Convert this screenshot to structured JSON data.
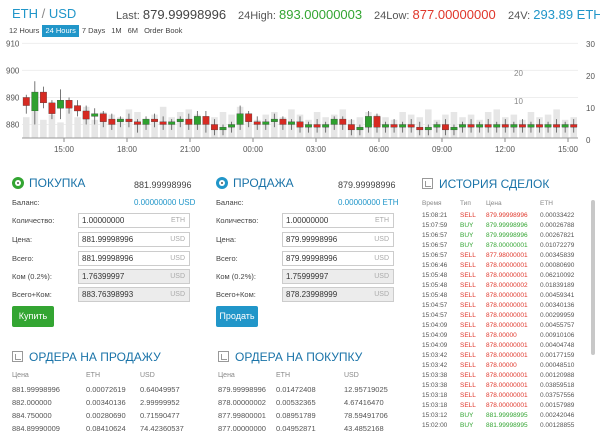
{
  "header": {
    "base": "ETH",
    "quote": "USD",
    "last_label": "Last:",
    "last_value": "879.99998996",
    "high_label": "24High:",
    "high_value": "893.00000003",
    "low_label": "24Low:",
    "low_value": "877.00000000",
    "vol_label": "24V:",
    "vol_value": "293.89 ETH"
  },
  "periods": [
    "12 Hours",
    "24 Hours",
    "7 Days",
    "1M",
    "6M",
    "Order Book"
  ],
  "active_period": "24 Hours",
  "chart_data": {
    "type": "candlestick",
    "y_ticks_left": [
      "910",
      "900",
      "890",
      "880"
    ],
    "y_ticks_right": [
      "30",
      "20",
      "10",
      "0"
    ],
    "y_ticks_right_partial": [
      "20",
      "10"
    ],
    "x_ticks": [
      "15:00",
      "18:00",
      "21:00",
      "00:00",
      "03:00",
      "06:00",
      "09:00",
      "12:00",
      "15:00"
    ],
    "colors": {
      "up": "#2ea02e",
      "down": "#d62a22",
      "volume": "#e6e6e6"
    },
    "candles": [
      [
        890,
        891,
        887,
        884
      ],
      [
        885,
        896,
        892,
        880
      ],
      [
        892,
        894,
        888,
        886
      ],
      [
        888,
        889,
        884,
        882
      ],
      [
        886,
        893,
        889,
        882
      ],
      [
        889,
        890,
        886,
        884
      ],
      [
        887,
        889,
        885,
        883
      ],
      [
        885,
        887,
        882,
        880
      ],
      [
        883,
        886,
        884,
        880
      ],
      [
        884,
        885,
        881,
        879
      ],
      [
        882,
        884,
        880,
        878
      ],
      [
        881,
        883,
        882,
        879
      ],
      [
        882,
        884,
        881,
        879
      ],
      [
        881,
        882,
        880,
        877
      ],
      [
        880,
        883,
        882,
        878
      ],
      [
        882,
        884,
        881,
        879
      ],
      [
        881,
        883,
        880,
        878
      ],
      [
        880,
        882,
        881,
        878
      ],
      [
        881,
        883,
        882,
        879
      ],
      [
        882,
        884,
        880,
        878
      ],
      [
        880,
        885,
        883,
        878
      ],
      [
        883,
        885,
        880,
        877
      ],
      [
        880,
        882,
        878,
        876
      ],
      [
        878,
        880,
        879,
        876
      ],
      [
        879,
        881,
        880,
        877
      ],
      [
        880,
        887,
        884,
        878
      ],
      [
        884,
        885,
        881,
        879
      ],
      [
        881,
        883,
        880,
        878
      ],
      [
        880,
        882,
        881,
        878
      ],
      [
        881,
        884,
        882,
        879
      ],
      [
        882,
        883,
        880,
        878
      ],
      [
        880,
        882,
        881,
        878
      ],
      [
        881,
        883,
        879,
        877
      ],
      [
        879,
        881,
        880,
        877
      ],
      [
        880,
        882,
        879,
        877
      ],
      [
        879,
        881,
        880,
        877
      ],
      [
        880,
        883,
        882,
        878
      ],
      [
        882,
        883,
        880,
        878
      ],
      [
        880,
        882,
        878,
        876
      ],
      [
        878,
        880,
        879,
        876
      ],
      [
        879,
        885,
        883,
        877
      ],
      [
        883,
        884,
        879,
        877
      ],
      [
        879,
        881,
        880,
        877
      ],
      [
        880,
        882,
        879,
        877
      ],
      [
        879,
        881,
        880,
        877
      ],
      [
        880,
        882,
        879,
        877
      ],
      [
        879,
        881,
        878,
        876
      ],
      [
        878,
        880,
        879,
        876
      ],
      [
        879,
        881,
        880,
        877
      ],
      [
        880,
        882,
        878,
        876
      ],
      [
        878,
        880,
        879,
        876
      ],
      [
        879,
        881,
        880,
        877
      ],
      [
        880,
        882,
        879,
        877
      ],
      [
        879,
        881,
        880,
        877
      ],
      [
        880,
        882,
        879,
        877
      ],
      [
        879,
        881,
        880,
        877
      ],
      [
        880,
        882,
        879,
        877
      ],
      [
        879,
        881,
        880,
        877
      ],
      [
        880,
        882,
        879,
        877
      ],
      [
        879,
        881,
        880,
        877
      ],
      [
        880,
        882,
        879,
        877
      ],
      [
        879,
        881,
        880,
        877
      ],
      [
        880,
        882,
        879,
        877
      ],
      [
        879,
        881,
        880,
        877
      ],
      [
        880,
        882,
        879,
        877
      ]
    ],
    "volumes": [
      8,
      10,
      7,
      9,
      6,
      11,
      8,
      12,
      7,
      10,
      9,
      8,
      11,
      10,
      7,
      9,
      12,
      8,
      10,
      11,
      9,
      7,
      8,
      10,
      9,
      12,
      8,
      7,
      9,
      10,
      8,
      11,
      9,
      7,
      10,
      8,
      9,
      11,
      7,
      8,
      10,
      9,
      8,
      7,
      10,
      9,
      8,
      11,
      7,
      9,
      10,
      8,
      9,
      7,
      10,
      11,
      8,
      9,
      7,
      10,
      8,
      9,
      11,
      7,
      8
    ]
  },
  "buy": {
    "title": "ПОКУПКА",
    "top_value": "881.99998996",
    "balance_label": "Баланс:",
    "balance_value": "0.00000000 USD",
    "qty_label": "Количество:",
    "qty_value": "1.00000000",
    "qty_unit": "ETH",
    "price_label": "Цена:",
    "price_value": "881.99998996",
    "price_unit": "USD",
    "total_label": "Всего:",
    "total_value": "881.99998996",
    "total_unit": "USD",
    "fee_label": "Ком (0.2%):",
    "fee_value": "1.76399997",
    "fee_unit": "USD",
    "grand_label": "Всего+Ком:",
    "grand_value": "883.76398993",
    "grand_unit": "USD",
    "button": "Купить"
  },
  "sell": {
    "title": "ПРОДАЖА",
    "top_value": "879.99998996",
    "balance_label": "Баланс:",
    "balance_value": "0.00000000 ETH",
    "qty_label": "Количество:",
    "qty_value": "1.00000000",
    "qty_unit": "ETH",
    "price_label": "Цена:",
    "price_value": "879.99998996",
    "price_unit": "USD",
    "total_label": "Всего:",
    "total_value": "879.99998996",
    "total_unit": "USD",
    "fee_label": "Ком (0.2%):",
    "fee_value": "1.75999997",
    "fee_unit": "USD",
    "grand_label": "Всего+Ком:",
    "grand_value": "878.23998999",
    "grand_unit": "USD",
    "button": "Продать"
  },
  "sell_orders": {
    "title": "ОРДЕРА НА ПРОДАЖУ",
    "headers": [
      "Цена",
      "ETH",
      "USD"
    ],
    "rows": [
      [
        "881.99998996",
        "0.00072619",
        "0.64049957"
      ],
      [
        "882.000000",
        "0.00340136",
        "2.99999952"
      ],
      [
        "884.750000",
        "0.00280690",
        "0.71590477"
      ],
      [
        "884.89990009",
        "0.08410624",
        "74.42360537"
      ]
    ]
  },
  "buy_orders": {
    "title": "ОРДЕРА НА ПОКУПКУ",
    "headers": [
      "Цена",
      "ETH",
      "USD"
    ],
    "rows": [
      [
        "879.99998996",
        "0.01472408",
        "12.95719025"
      ],
      [
        "878.00000002",
        "0.00532365",
        "4.67416470"
      ],
      [
        "877.99800001",
        "0.08951789",
        "78.59491706"
      ],
      [
        "877.00000000",
        "0.04952871",
        "43.4852168"
      ]
    ]
  },
  "history": {
    "title": "ИСТОРИЯ СДЕЛОК",
    "headers": [
      "Время",
      "Тип",
      "Цена",
      "ETH"
    ],
    "rows": [
      [
        "15:08:21",
        "SELL",
        "879.99998996",
        "0.00033422"
      ],
      [
        "15:07:59",
        "BUY",
        "879.99998996",
        "0.00026788"
      ],
      [
        "15:06:57",
        "BUY",
        "879.99998996",
        "0.00267821"
      ],
      [
        "15:06:57",
        "BUY",
        "878.00000001",
        "0.01072279"
      ],
      [
        "15:06:57",
        "SELL",
        "877.98000001",
        "0.00345839"
      ],
      [
        "15:06:46",
        "SELL",
        "878.00000001",
        "0.00080690"
      ],
      [
        "15:05:48",
        "SELL",
        "878.00000001",
        "0.06210092"
      ],
      [
        "15:05:48",
        "SELL",
        "878.00000002",
        "0.01839189"
      ],
      [
        "15:05:48",
        "SELL",
        "878.00000001",
        "0.00459341"
      ],
      [
        "15:04:57",
        "SELL",
        "878.00000001",
        "0.00340136"
      ],
      [
        "15:04:57",
        "SELL",
        "878.00000001",
        "0.00299959"
      ],
      [
        "15:04:09",
        "SELL",
        "878.00000001",
        "0.00455757"
      ],
      [
        "15:04:09",
        "SELL",
        "878.00000",
        "0.00910106"
      ],
      [
        "15:04:09",
        "SELL",
        "878.00000001",
        "0.00404748"
      ],
      [
        "15:03:42",
        "SELL",
        "878.00000001",
        "0.00177159"
      ],
      [
        "15:03:42",
        "SELL",
        "878.00000",
        "0.00048510"
      ],
      [
        "15:03:38",
        "SELL",
        "878.00000001",
        "0.00120988"
      ],
      [
        "15:03:38",
        "SELL",
        "878.00000001",
        "0.03859518"
      ],
      [
        "15:03:18",
        "SELL",
        "878.00000001",
        "0.03757556"
      ],
      [
        "15:03:18",
        "SELL",
        "878.00000001",
        "0.00157989"
      ],
      [
        "15:03:12",
        "BUY",
        "881.99998995",
        "0.00242046"
      ],
      [
        "15:02:00",
        "BUY",
        "881.99998995",
        "0.00128855"
      ]
    ]
  }
}
